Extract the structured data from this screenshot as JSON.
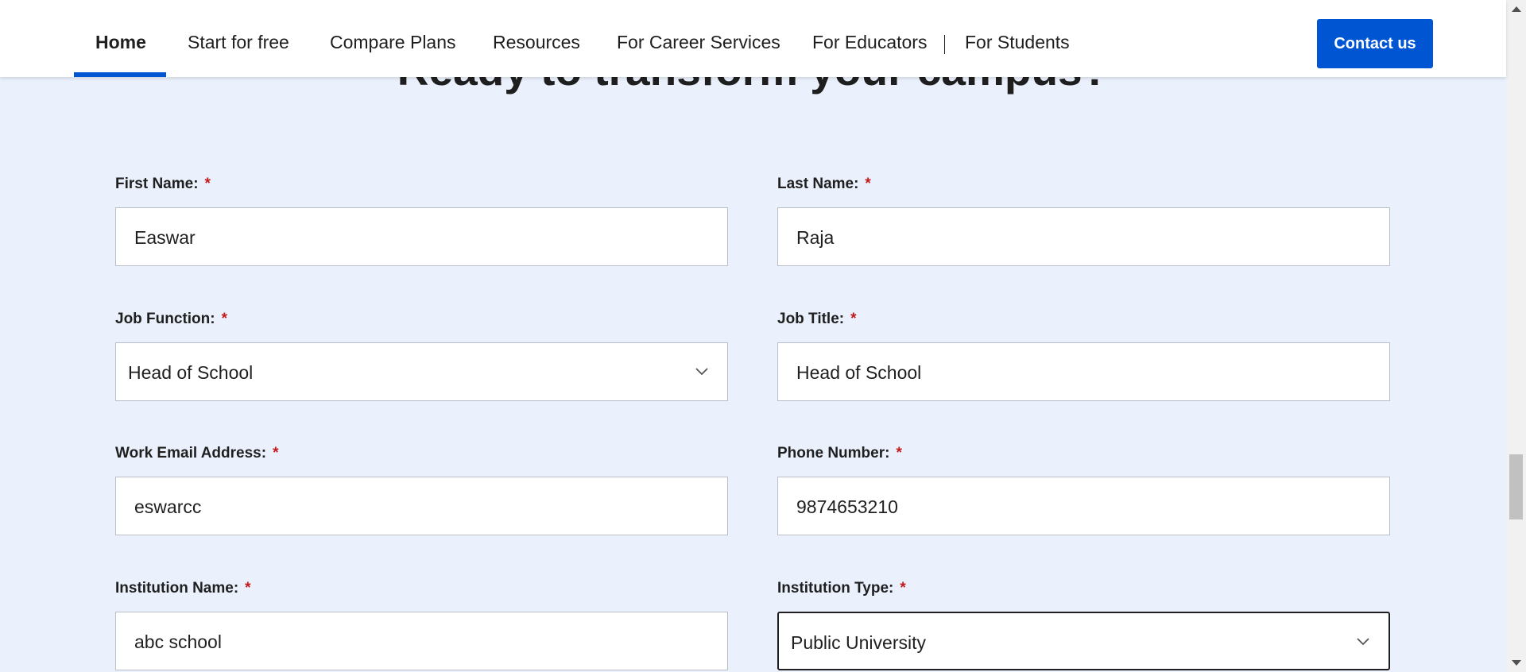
{
  "nav": {
    "items": [
      {
        "label": "Home",
        "active": true
      },
      {
        "label": "Start for free"
      },
      {
        "label": "Compare Plans"
      },
      {
        "label": "Resources"
      },
      {
        "label": "For Career Services"
      },
      {
        "label": "For Educators"
      },
      {
        "label": "For Students"
      }
    ],
    "contact_label": "Contact us"
  },
  "heading": "Ready to transform your campus?",
  "form": {
    "required_marker": "*",
    "first_name": {
      "label": "First Name:",
      "value": "Easwar"
    },
    "last_name": {
      "label": "Last Name:",
      "value": "Raja"
    },
    "job_function": {
      "label": "Job Function:",
      "value": "Head of School"
    },
    "job_title": {
      "label": "Job Title:",
      "value": "Head of School"
    },
    "work_email": {
      "label": "Work Email Address:",
      "value": "eswarcc"
    },
    "phone": {
      "label": "Phone Number:",
      "value": "9874653210"
    },
    "institution_name": {
      "label": "Institution Name:",
      "value": "abc school"
    },
    "institution_type": {
      "label": "Institution Type:",
      "value": "Public University"
    }
  },
  "icons": {
    "select_arrow": "chevron-down-icon"
  },
  "colors": {
    "brand_blue": "#0056d2",
    "page_background": "#eaf1fc",
    "required_red": "#c41a1a"
  }
}
